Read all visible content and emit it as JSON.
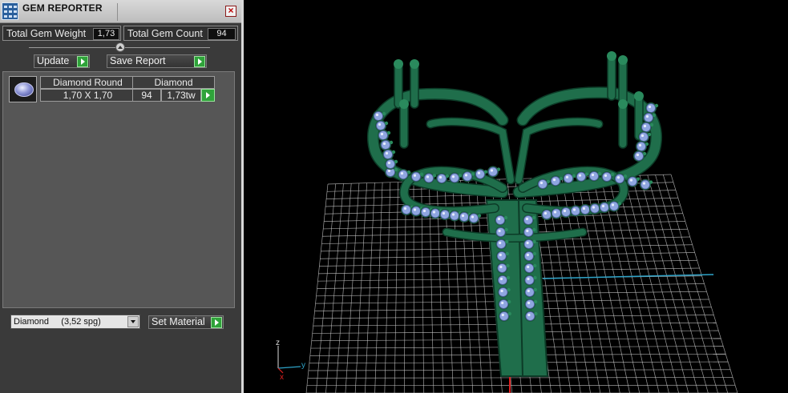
{
  "window": {
    "title": "GEM REPORTER",
    "close_label": "×"
  },
  "stats": {
    "total_weight_label": "Total Gem Weight",
    "total_weight_value": "1,73",
    "total_count_label": "Total Gem Count",
    "total_count_value": "94"
  },
  "actions": {
    "update_label": "Update",
    "save_report_label": "Save Report",
    "set_material_label": "Set Material"
  },
  "gem_table": {
    "headers": [
      "Diamond Round",
      "Diamond"
    ],
    "rows": [
      {
        "size": "1,70 X 1,70",
        "count": "94",
        "weight": "1,73tw"
      }
    ]
  },
  "material": {
    "selected": "Diamond     (3,52 spg)"
  },
  "viewport": {
    "axes": {
      "z": "z",
      "y": "y",
      "x": "x"
    },
    "colors": {
      "metal": "#1f6e4b",
      "gem": "#8fa6e0",
      "grid": "#cfcfcf",
      "axis_y": "#2ea3c8",
      "axis_x": "#e02020"
    }
  }
}
